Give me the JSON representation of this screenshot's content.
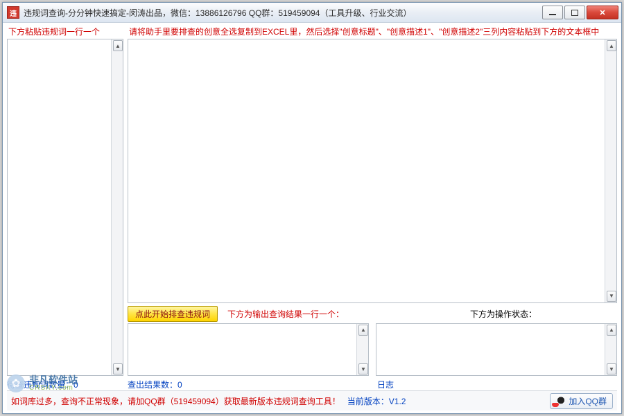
{
  "titlebar": {
    "icon_letter": "违",
    "title": "违规词查询-分分钟快速搞定-闵涛出品，微信：13886126796 QQ群：519459094（工具升级、行业交流）"
  },
  "left": {
    "label": "下方粘贴违规词一行一个",
    "count_label": "待查违规词数量：",
    "count_value": "0"
  },
  "right": {
    "top_label": "请将助手里要排查的创意全选复制到EXCEL里，然后选择\"创意标题\"、\"创意描述1\"、\"创意描述2\"三列内容粘贴到下方的文本框中",
    "button": "点此开始排查违规词",
    "result_label": "下方为输出查询结果一行一个：",
    "status_label": "下方为操作状态：",
    "result_count_label": "查出结果数：",
    "result_count_value": "0",
    "log_label": "日志"
  },
  "footer": {
    "prefix": "如词库过多，查询不正常现象，请加QQ群（519459094）获取最新版本违规词查询工具！",
    "version_label": "当前版本：",
    "version_value": "V1.2",
    "join_btn": "加入QQ群"
  },
  "watermark": {
    "name": "非凡软件站",
    "domain": "CRSKY.com"
  }
}
